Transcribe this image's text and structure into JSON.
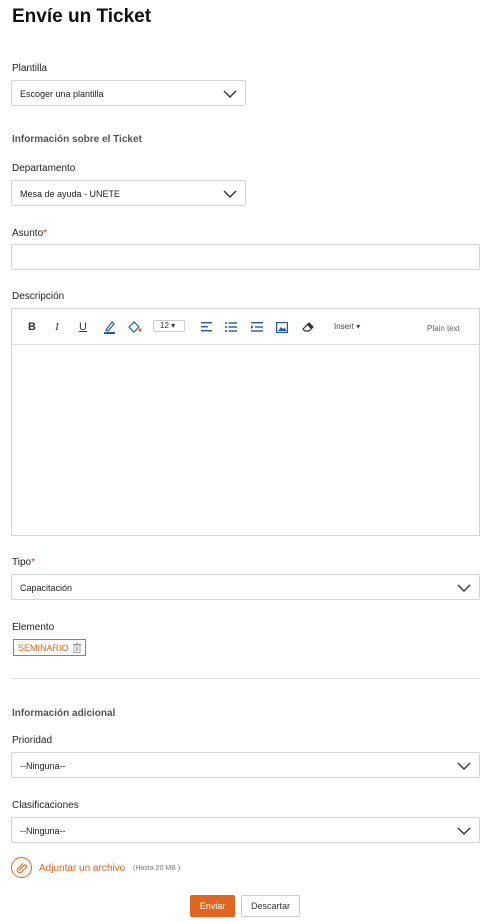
{
  "page": {
    "title": "Envíe un Ticket"
  },
  "template": {
    "label": "Plantilla",
    "value": "Escoger una plantilla"
  },
  "ticket_info": {
    "heading": "Información sobre el Ticket"
  },
  "department": {
    "label": "Departamento",
    "value": "Mesa de ayuda - UNETE"
  },
  "subject": {
    "label": "Asunto",
    "required_mark": "*",
    "value": ""
  },
  "description": {
    "label": "Descripción",
    "toolbar": {
      "bold": "B",
      "italic": "I",
      "underline": "U",
      "font_size": "12",
      "insert": "Insert",
      "plain_text": "Plain text"
    },
    "value": ""
  },
  "type": {
    "label": "Tipo",
    "required_mark": "*",
    "value": "Capacitación"
  },
  "element": {
    "label": "Elemento",
    "tag": "SEMINARIO"
  },
  "additional_info": {
    "heading": "Información adicional"
  },
  "priority": {
    "label": "Prioridad",
    "value": "--Ninguna--"
  },
  "classifications": {
    "label": "Clasificaciones",
    "value": "--Ninguna--"
  },
  "attachment": {
    "link": "Adjuntar un archivo",
    "hint": "(Hasta 20 MB )"
  },
  "actions": {
    "submit": "Enviar",
    "discard": "Descartar"
  },
  "colors": {
    "accent": "#e0651f",
    "required": "#d9342b",
    "border": "#d5d5d5"
  }
}
